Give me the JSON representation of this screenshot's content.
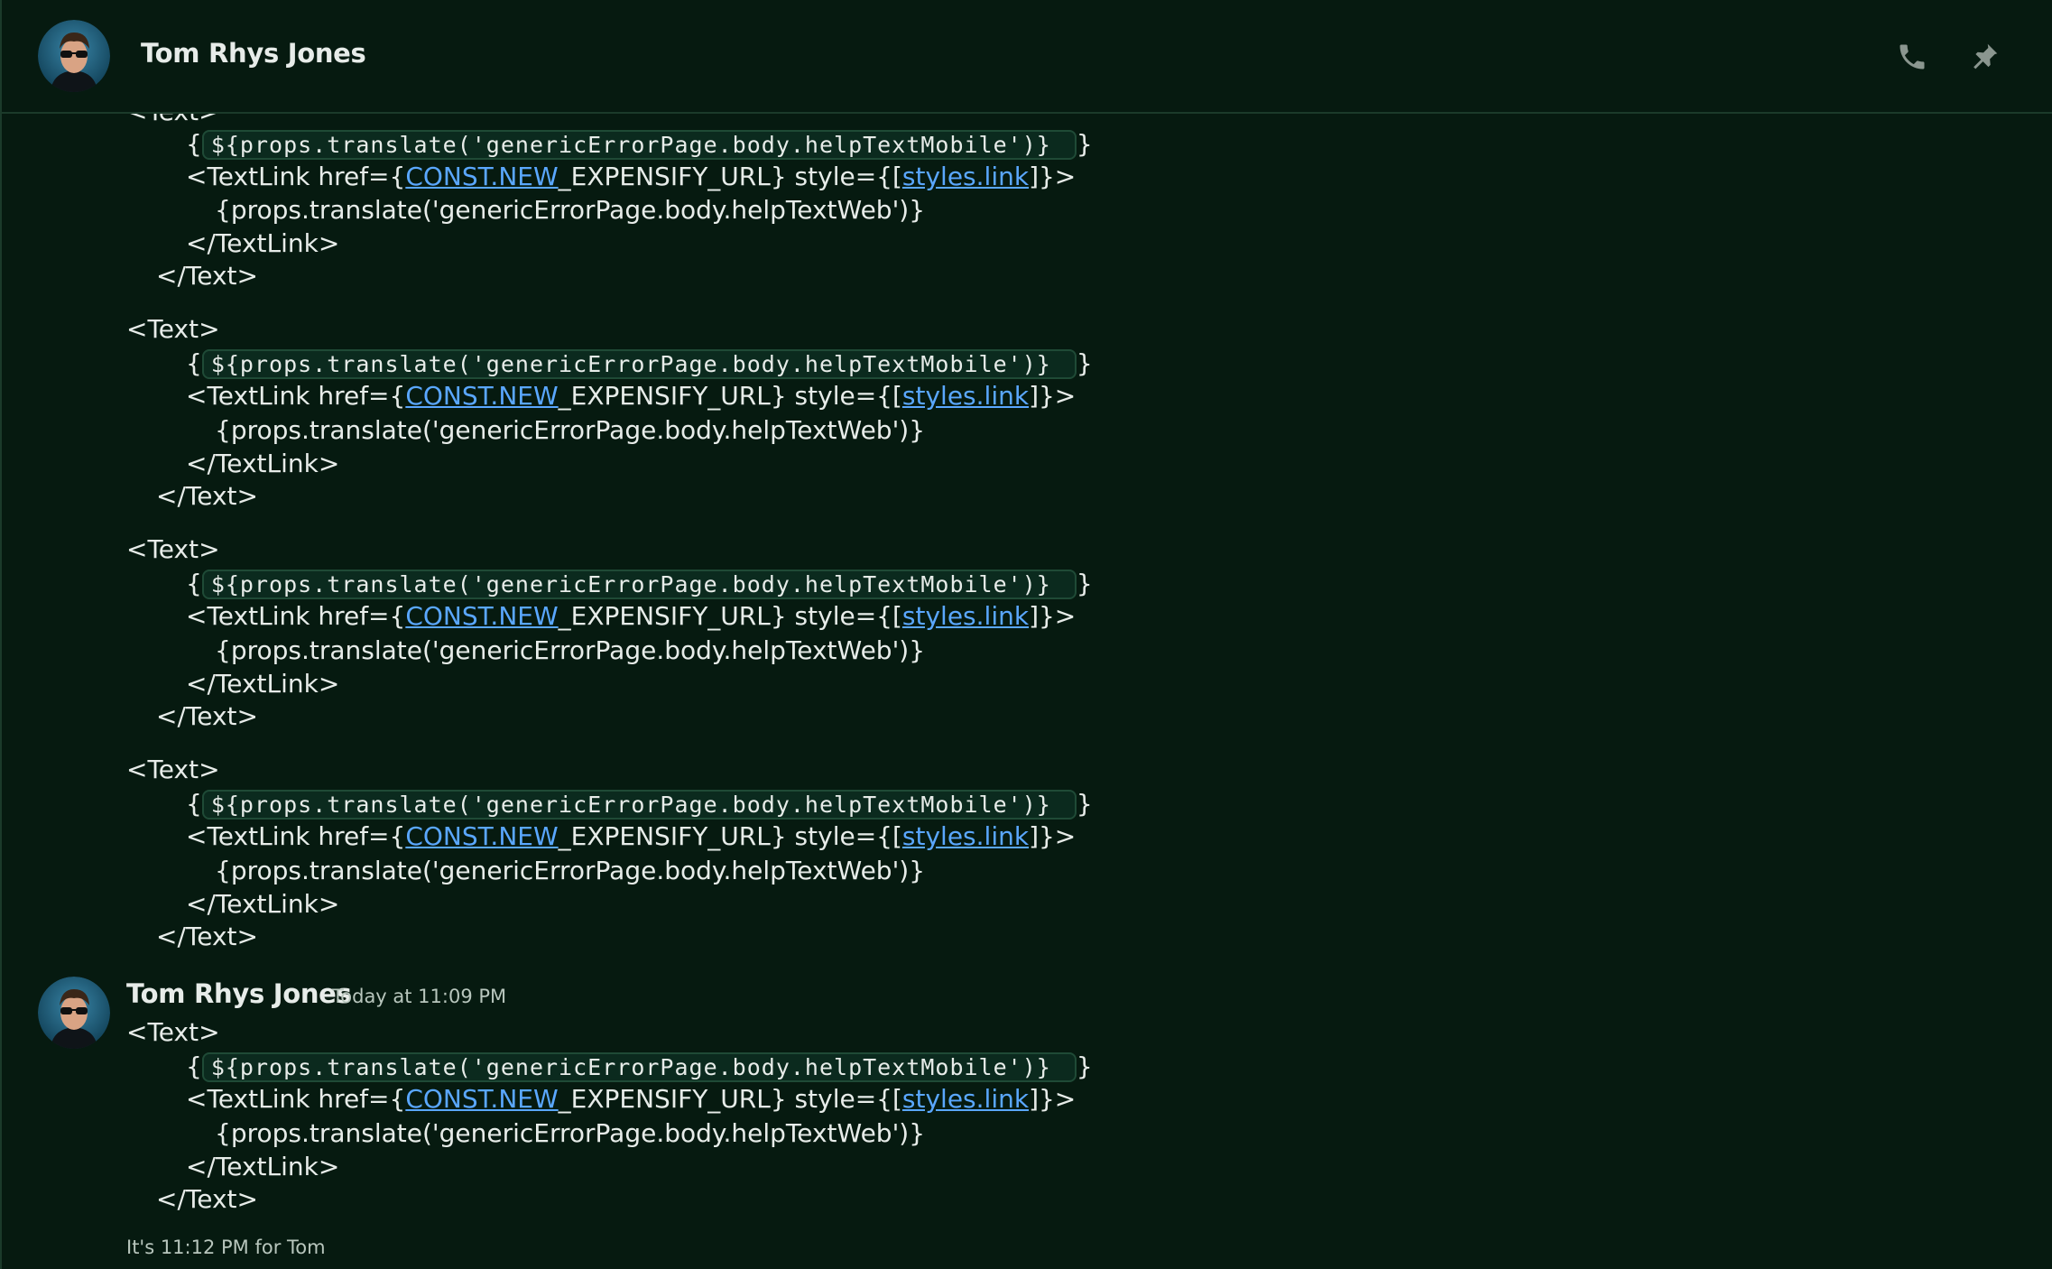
{
  "header": {
    "name": "Tom Rhys Jones",
    "call_icon": "phone-icon",
    "pin_icon": "pin-icon"
  },
  "code": {
    "open_text": "<Text>",
    "brace_open": "{",
    "inline_code": "${props.translate('genericErrorPage.body.helpTextMobile')}",
    "brace_close": "}",
    "textlink_prefix": "<TextLink href={",
    "const_link": "CONST.NEW",
    "textlink_middle": "_EXPENSIFY_URL} style={[",
    "styles_link": "styles.link",
    "textlink_suffix": "]}>",
    "translate_web": "{props.translate('genericErrorPage.body.helpTextWeb')}",
    "close_textlink": "</TextLink>",
    "close_text": "</Text>"
  },
  "message": {
    "author": "Tom Rhys Jones",
    "timestamp": "Today at 11:09 PM"
  },
  "footer": {
    "local_time": "It's 11:12 PM for Tom"
  },
  "colors": {
    "background": "#061a10",
    "link": "#5aa7ff",
    "code_bg": "#0b2a1e",
    "muted_text": "#b8c6bd"
  }
}
